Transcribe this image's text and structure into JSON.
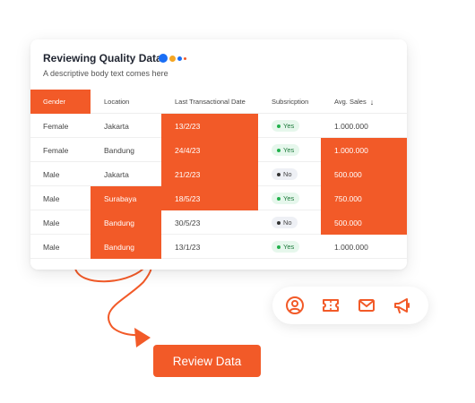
{
  "card": {
    "title": "Reviewing Quality Data",
    "description": "A descriptive body text comes here"
  },
  "colors": {
    "accent": "#f25a28",
    "dot_blue": "#1a6ef5",
    "dot_orange": "#f5a623",
    "dot_small": "#f25a28",
    "yes_green": "#22b14c"
  },
  "table": {
    "headers": {
      "gender": "Gender",
      "location": "Location",
      "last_date": "Last Transactional Date",
      "subscription": "Subsricption",
      "avg_sales": "Avg. Sales"
    },
    "rows": [
      {
        "gender": "Female",
        "location": "Jakarta",
        "date": "13/2/23",
        "subscription": "Yes",
        "sales": "1.000.000"
      },
      {
        "gender": "Female",
        "location": "Bandung",
        "date": "24/4/23",
        "subscription": "Yes",
        "sales": "1.000.000"
      },
      {
        "gender": "Male",
        "location": "Jakarta",
        "date": "21/2/23",
        "subscription": "No",
        "sales": "500.000"
      },
      {
        "gender": "Male",
        "location": "Surabaya",
        "date": "18/5/23",
        "subscription": "Yes",
        "sales": "750.000"
      },
      {
        "gender": "Male",
        "location": "Bandung",
        "date": "30/5/23",
        "subscription": "No",
        "sales": "500.000"
      },
      {
        "gender": "Male",
        "location": "Bandung",
        "date": "13/1/23",
        "subscription": "Yes",
        "sales": "1.000.000"
      }
    ]
  },
  "icons": [
    "user-circle-icon",
    "ticket-icon",
    "mail-icon",
    "megaphone-icon"
  ],
  "cta": {
    "label": "Review Data"
  }
}
